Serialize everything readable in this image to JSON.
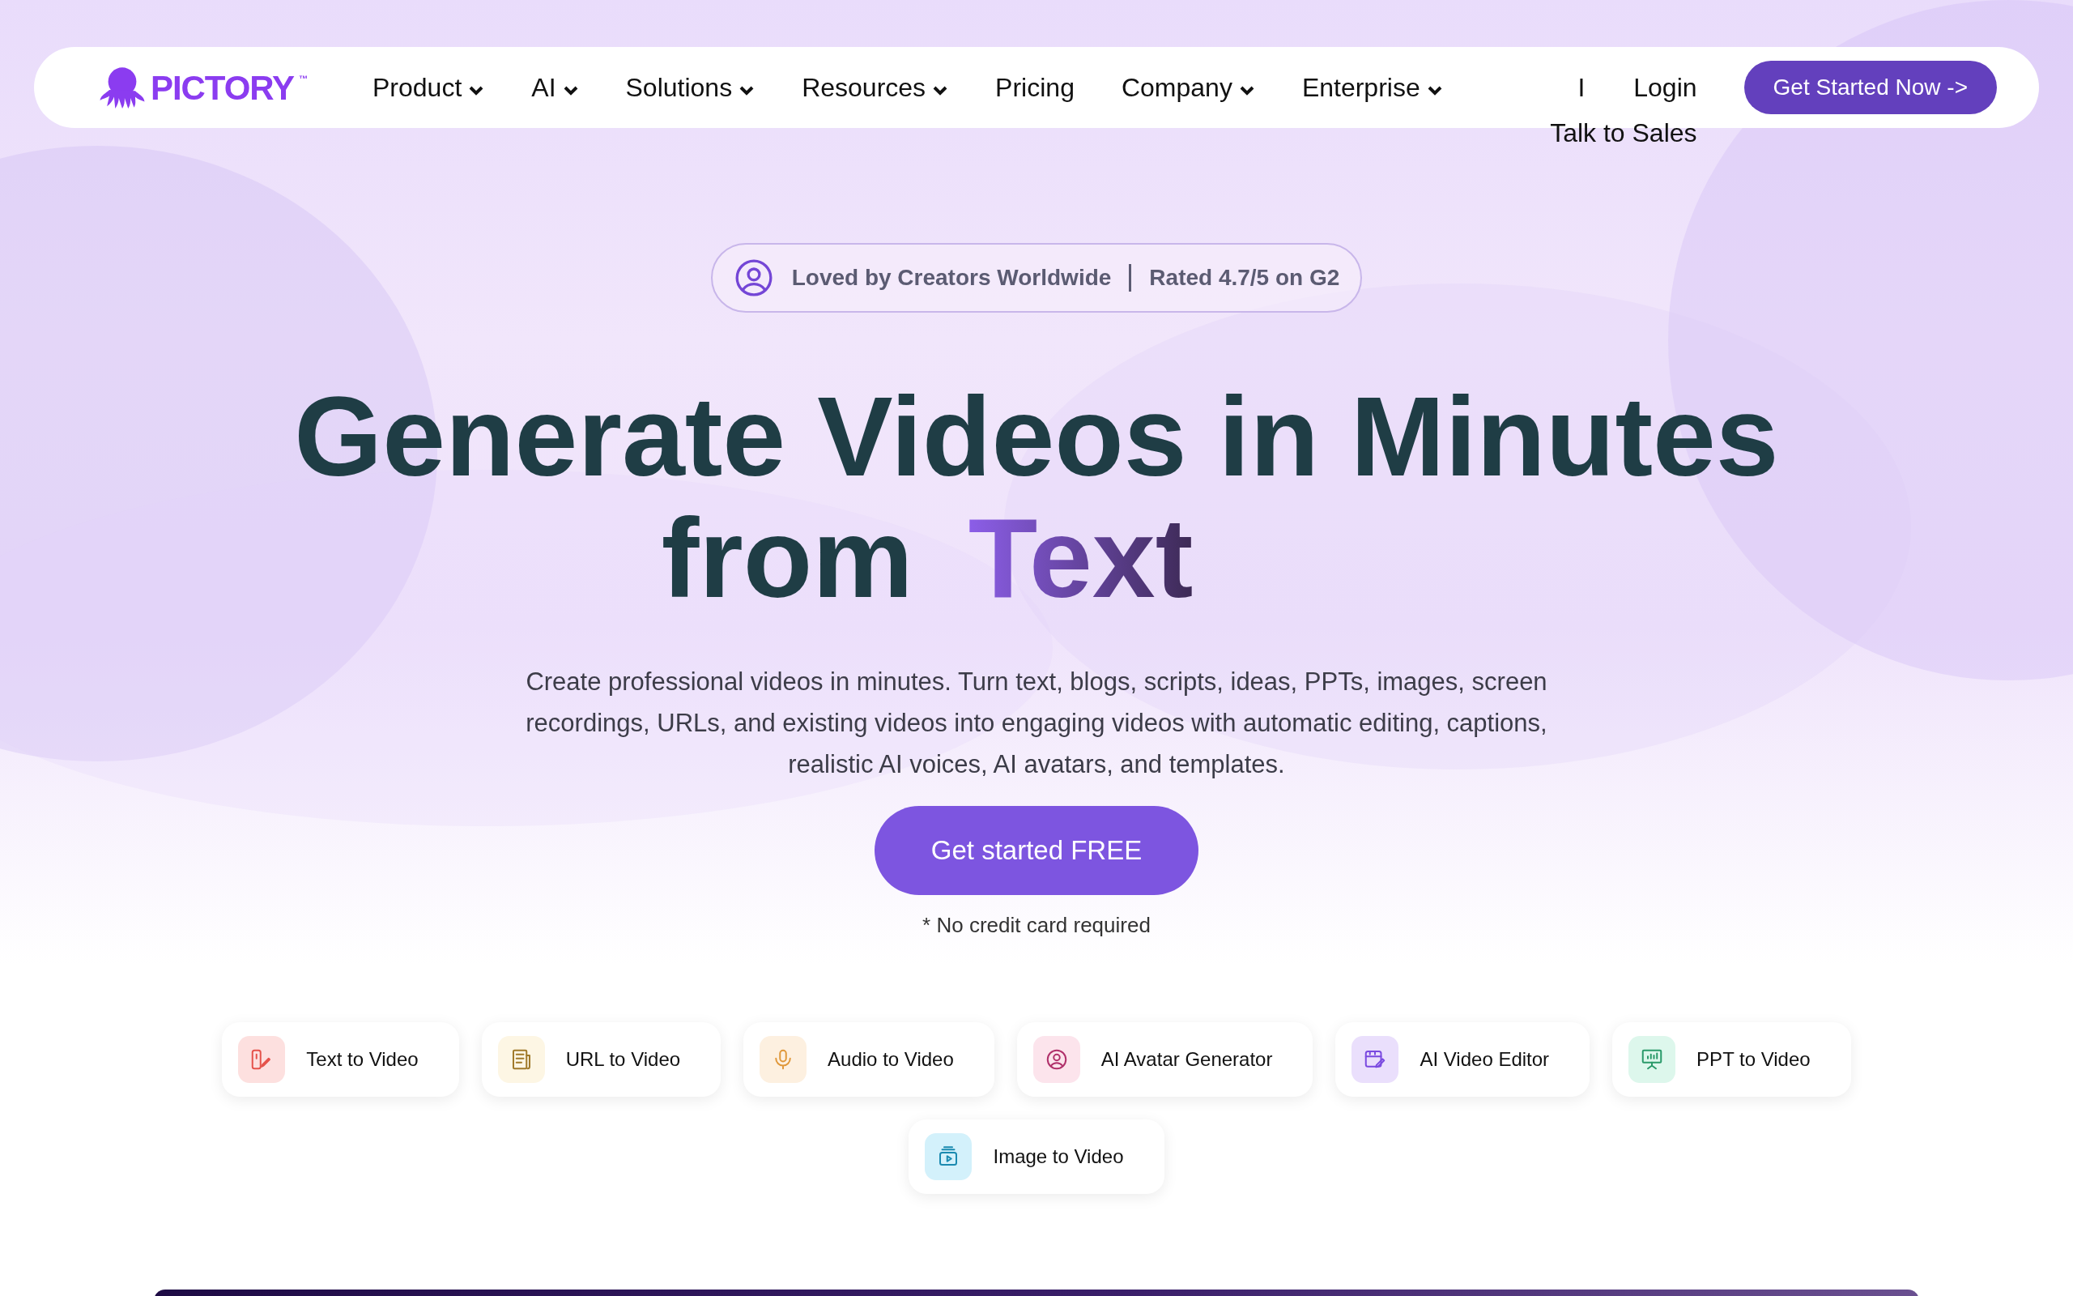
{
  "nav": {
    "logo": {
      "text": "PICTORY",
      "trademark": "™"
    },
    "items": [
      {
        "label": "Product",
        "has_menu": true
      },
      {
        "label": "AI",
        "has_menu": true
      },
      {
        "label": "Solutions",
        "has_menu": true
      },
      {
        "label": "Resources",
        "has_menu": true
      },
      {
        "label": "Pricing",
        "has_menu": false
      },
      {
        "label": "Company",
        "has_menu": true
      },
      {
        "label": "Enterprise",
        "has_menu": true
      }
    ],
    "separator": "I",
    "login": "Login",
    "talk_to_sales": "Talk to Sales",
    "cta": "Get Started Now ->"
  },
  "badge": {
    "left": "Loved by Creators Worldwide",
    "right": "Rated 4.7/5 on G2"
  },
  "hero": {
    "title_line_1": "Generate Videos in Minutes",
    "title_line_2": "from",
    "title_highlight": "Text",
    "description": "Create professional videos in minutes. Turn text, blogs, scripts, ideas, PPTs, images, screen recordings, URLs, and existing videos into engaging videos with automatic editing, captions, realistic AI voices, AI avatars, and templates.",
    "cta": "Get started FREE",
    "note": "* No credit card required"
  },
  "features": [
    {
      "label": "Text to Video",
      "kind": "text",
      "color": "#e5534b"
    },
    {
      "label": "URL to Video",
      "kind": "url",
      "color": "#a07a2a"
    },
    {
      "label": "Audio to Video",
      "kind": "audio",
      "color": "#e0983a"
    },
    {
      "label": "AI Avatar Generator",
      "kind": "avatar",
      "color": "#b0306a"
    },
    {
      "label": "AI Video Editor",
      "kind": "editor",
      "color": "#7a4ae0"
    },
    {
      "label": "PPT to Video",
      "kind": "ppt",
      "color": "#2a9a6a"
    },
    {
      "label": "Image to Video",
      "kind": "image",
      "color": "#1a8ab0"
    }
  ]
}
